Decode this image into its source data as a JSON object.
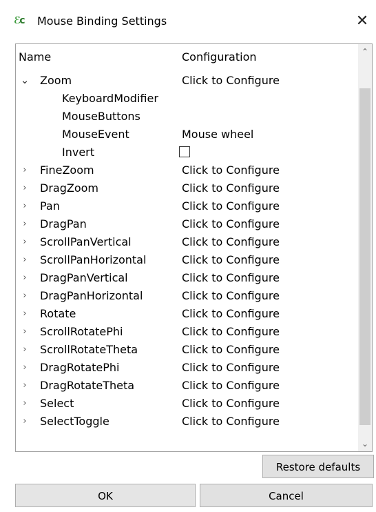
{
  "window": {
    "title": "Mouse Binding Settings",
    "close_glyph": "✕"
  },
  "tree": {
    "columns": {
      "name": "Name",
      "configuration": "Configuration"
    },
    "zoom": {
      "label": "Zoom",
      "config": "Click to Configure",
      "expanded": true,
      "children": [
        {
          "label": "KeyboardModifier",
          "value": ""
        },
        {
          "label": "MouseButtons",
          "value": ""
        },
        {
          "label": "MouseEvent",
          "value": "Mouse wheel"
        },
        {
          "label": "Invert",
          "value": "",
          "checkbox": true,
          "checked": false
        }
      ]
    },
    "items": [
      {
        "label": "FineZoom",
        "config": "Click to Configure"
      },
      {
        "label": "DragZoom",
        "config": "Click to Configure"
      },
      {
        "label": "Pan",
        "config": "Click to Configure"
      },
      {
        "label": "DragPan",
        "config": "Click to Configure"
      },
      {
        "label": "ScrollPanVertical",
        "config": "Click to Configure"
      },
      {
        "label": "ScrollPanHorizontal",
        "config": "Click to Configure"
      },
      {
        "label": "DragPanVertical",
        "config": "Click to Configure"
      },
      {
        "label": "DragPanHorizontal",
        "config": "Click to Configure"
      },
      {
        "label": "Rotate",
        "config": "Click to Configure"
      },
      {
        "label": "ScrollRotatePhi",
        "config": "Click to Configure"
      },
      {
        "label": "ScrollRotateTheta",
        "config": "Click to Configure"
      },
      {
        "label": "DragRotatePhi",
        "config": "Click to Configure"
      },
      {
        "label": "DragRotateTheta",
        "config": "Click to Configure"
      },
      {
        "label": "Select",
        "config": "Click to Configure"
      },
      {
        "label": "SelectToggle",
        "config": "Click to Configure"
      }
    ]
  },
  "buttons": {
    "restore_defaults": "Restore defaults",
    "ok": "OK",
    "cancel": "Cancel"
  },
  "icons": {
    "app": "app-logo-icon",
    "close": "close-icon",
    "expanded": "chevron-down-icon",
    "collapsed": "chevron-right-icon",
    "scroll_up": "scroll-up-arrow-icon",
    "scroll_down": "scroll-down-arrow-icon"
  },
  "colors": {
    "app_icon": "#3a9a3a",
    "button_bg": "#e1e1e1",
    "border": "#a0a0a0",
    "scroll_track": "#f0f0f0",
    "scroll_thumb": "#cdcdcd"
  }
}
